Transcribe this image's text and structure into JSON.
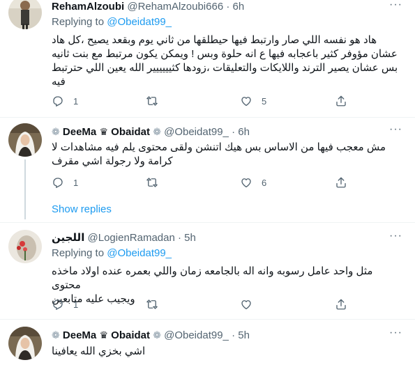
{
  "colors": {
    "accent": "#1d9bf0",
    "muted": "#536471",
    "text": "#0f1419"
  },
  "tweets": [
    {
      "name": "RehamAlzoubi",
      "handle": "@RehamAlzoubi666",
      "sep": "·",
      "time": "6h",
      "replying_label": "Replying to",
      "replying_handle": "@Obeidat99_",
      "text_lines": [
        "هاد هو نفسه اللي صار وارتبط فيها حيطلقها من ثاني يوم وبقعد يصيح ،كل هاد",
        "عشان مؤوفر كثير باعجابه فيها ع انه حلوة وبس ! ويمكن يكون مرتبط مع بنت ثانيه",
        "بس عشان يصير الترند واللايكات والتعليقات ،زودها كثيييييير الله يعين اللي حترتبط",
        "فيه"
      ],
      "replies": "1",
      "retweets": "",
      "likes": "5"
    },
    {
      "name_prefix": "DeeMa",
      "crown": "♛",
      "name_suffix": "Obaidat",
      "flower": "❁",
      "handle": "@Obeidat99_",
      "sep": "·",
      "time": "6h",
      "text_lines": [
        "مش معجب فيها من الاساس بس هيك اتنشن ولقى محتوى يلم فيه مشاهدات لا",
        "كرامة ولا رجولة اشي مقرف"
      ],
      "replies": "1",
      "retweets": "",
      "likes": "6"
    },
    {
      "name": "اللجين",
      "handle": "@LogienRamadan",
      "sep": "·",
      "time": "5h",
      "replying_label": "Replying to",
      "replying_handle": "@Obeidat99_",
      "text_lines": [
        "مثل واحد عامل رسوبه وانه اله بالجامعه زمان واللي بعمره عنده اولاد ماخذه محتوى",
        "ويجيب عليه متابعين"
      ],
      "replies": "1",
      "retweets": "",
      "likes": ""
    },
    {
      "name_prefix": "DeeMa",
      "crown": "♛",
      "name_suffix": "Obaidat",
      "flower": "❁",
      "handle": "@Obeidat99_",
      "sep": "·",
      "time": "5h",
      "text_lines": [
        "اشي بخزي الله يعافينا"
      ]
    }
  ],
  "show_replies": "Show replies",
  "more_label": "···"
}
